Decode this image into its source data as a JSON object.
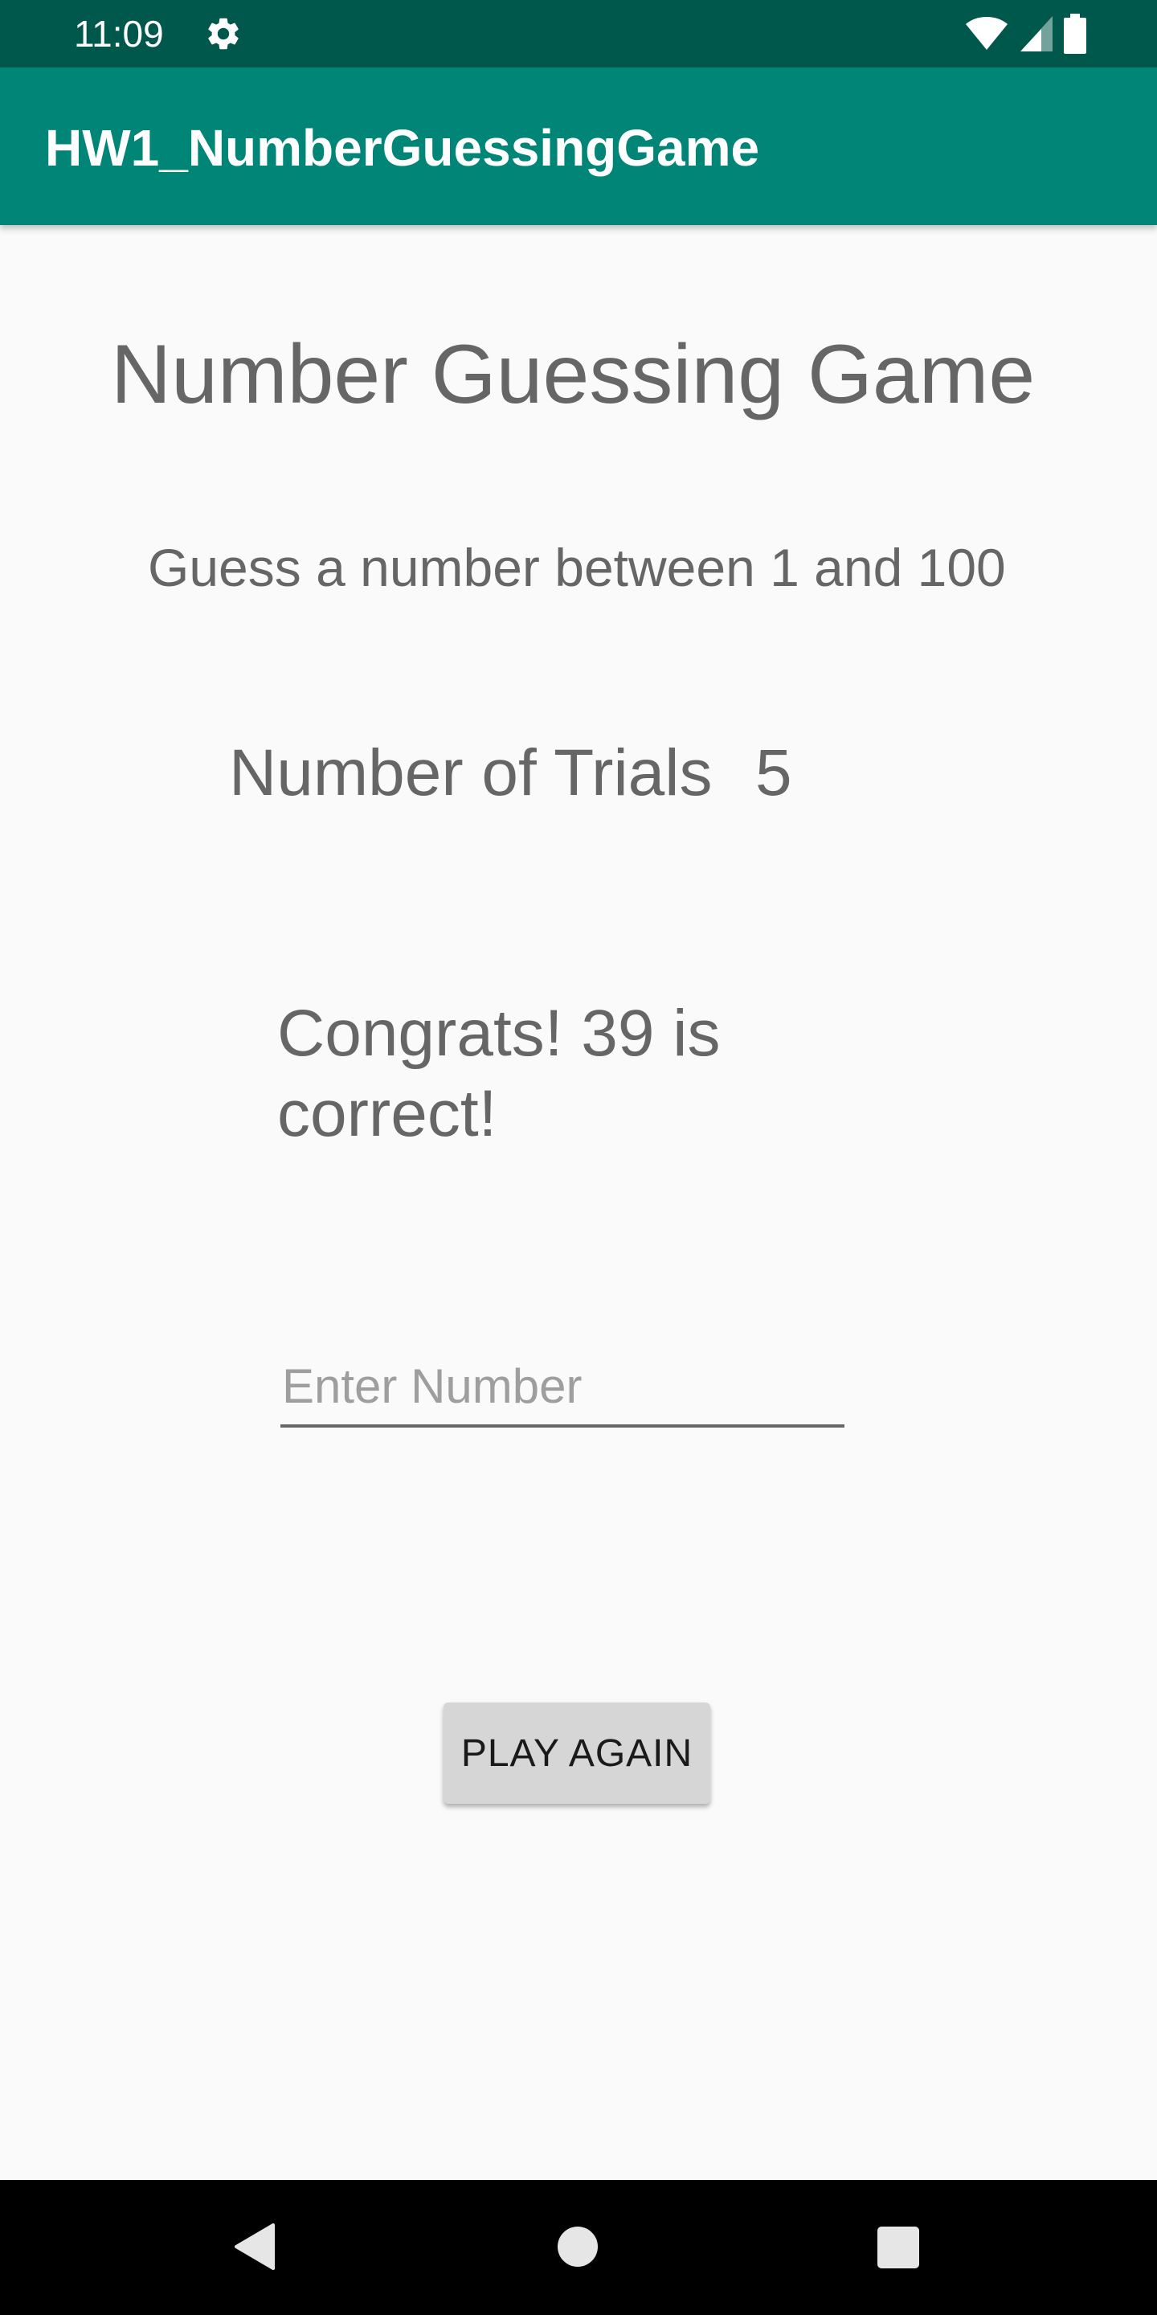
{
  "status_bar": {
    "time": "11:09",
    "icons": [
      "gear-icon",
      "wifi-icon",
      "cell-signal-icon",
      "battery-icon"
    ],
    "background": "#00574B"
  },
  "app_bar": {
    "title": "HW1_NumberGuessingGame",
    "background": "#008577"
  },
  "main": {
    "title": "Number Guessing Game",
    "subtitle": "Guess a number between 1 and 100",
    "trials_label": "Number of Trials",
    "trials_value": "5",
    "message": "Congrats! 39 is correct!",
    "input": {
      "placeholder": "Enter Number",
      "value": ""
    },
    "button_label": "PLAY AGAIN"
  },
  "nav_bar": {
    "icons": [
      "back-icon",
      "home-icon",
      "recents-icon"
    ]
  }
}
